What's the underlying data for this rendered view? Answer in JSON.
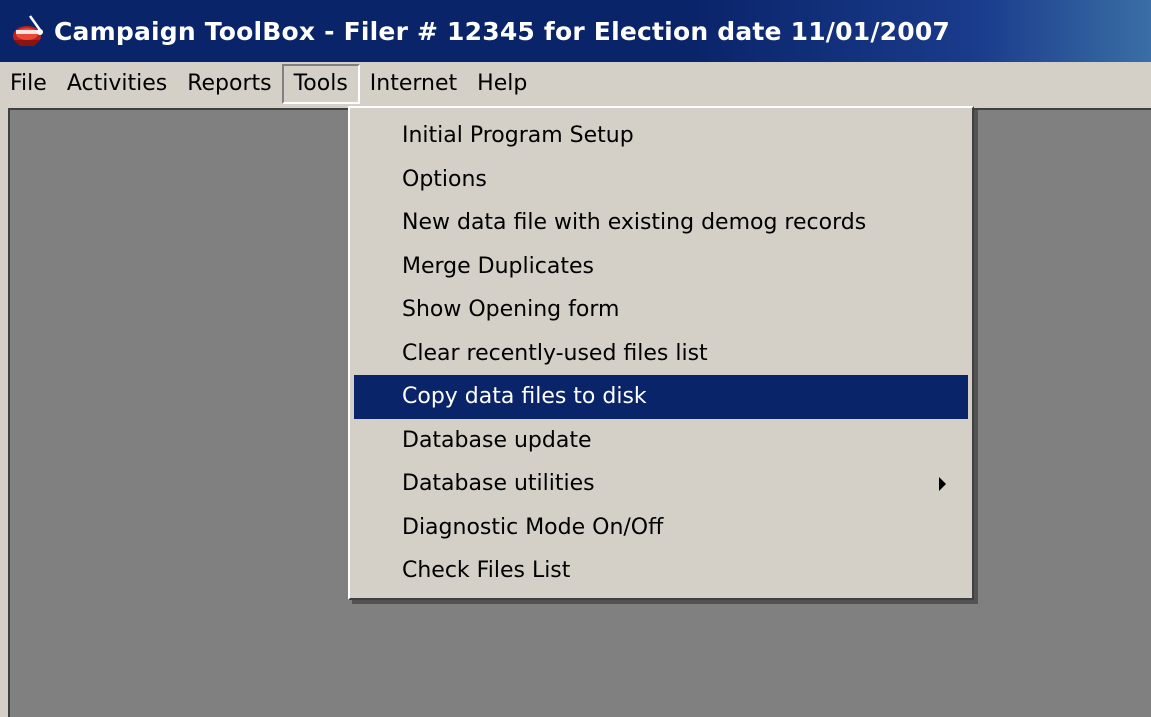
{
  "window": {
    "title": "Campaign ToolBox - Filer # 12345 for Election date 11/01/2007",
    "icon": "campaign-toolbox-logo-icon",
    "title_bar_color": "#0a246a"
  },
  "menubar": {
    "items": [
      {
        "label": "File"
      },
      {
        "label": "Activities"
      },
      {
        "label": "Reports"
      },
      {
        "label": "Tools",
        "open": true
      },
      {
        "label": "Internet"
      },
      {
        "label": "Help"
      }
    ]
  },
  "tools_menu": {
    "items": [
      {
        "label": "Initial Program Setup"
      },
      {
        "label": "Options"
      },
      {
        "label": "New data file with existing demog records"
      },
      {
        "label": "Merge Duplicates"
      },
      {
        "label": "Show Opening form"
      },
      {
        "label": "Clear recently-used files list"
      },
      {
        "label": "Copy data files to disk",
        "selected": true
      },
      {
        "label": "Database update"
      },
      {
        "label": "Database utilities",
        "submenu": true,
        "submenu_icon": "chevron-right-icon"
      },
      {
        "label": "Diagnostic Mode On/Off"
      },
      {
        "label": "Check Files List"
      }
    ],
    "selection_color": "#0a246a"
  },
  "colors": {
    "workspace": "#808080",
    "chrome": "#d4d0c8"
  }
}
